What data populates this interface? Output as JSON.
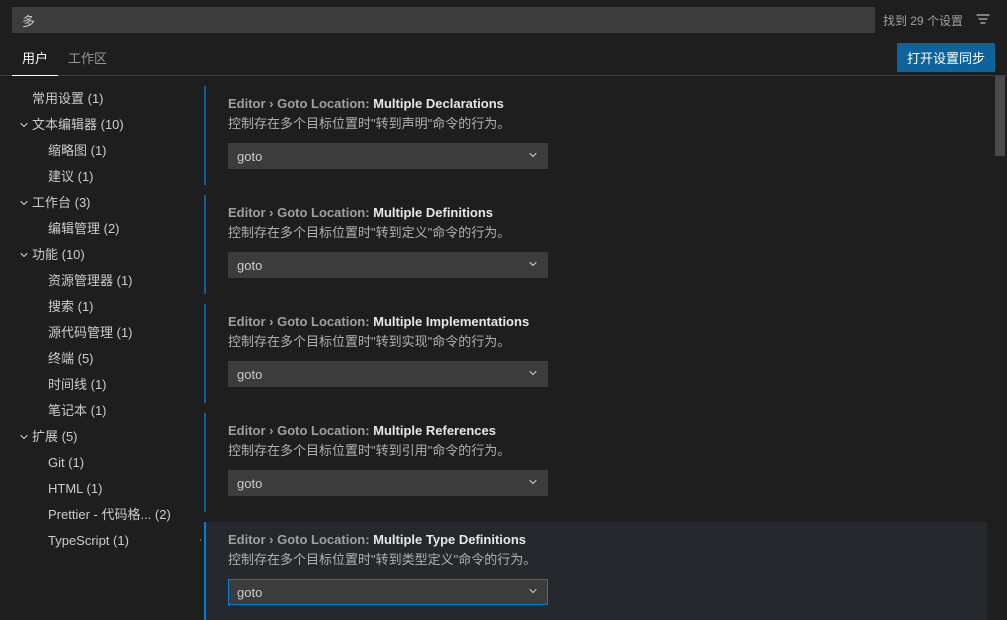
{
  "search": {
    "query": "多",
    "count": "找到 29 个设置"
  },
  "tabs": {
    "user": "用户",
    "workspace": "工作区",
    "sync": "打开设置同步"
  },
  "sidebar": [
    {
      "label": "常用设置 (1)",
      "kind": "leaf"
    },
    {
      "label": "文本编辑器 (10)",
      "kind": "expand",
      "children": [
        {
          "label": "缩略图 (1)"
        },
        {
          "label": "建议 (1)"
        }
      ]
    },
    {
      "label": "工作台 (3)",
      "kind": "expand",
      "children": [
        {
          "label": "编辑管理 (2)"
        }
      ]
    },
    {
      "label": "功能 (10)",
      "kind": "expand",
      "children": [
        {
          "label": "资源管理器 (1)"
        },
        {
          "label": "搜索 (1)"
        },
        {
          "label": "源代码管理 (1)"
        },
        {
          "label": "终端 (5)"
        },
        {
          "label": "时间线 (1)"
        },
        {
          "label": "笔记本 (1)"
        }
      ]
    },
    {
      "label": "扩展 (5)",
      "kind": "expand",
      "children": [
        {
          "label": "Git (1)"
        },
        {
          "label": "HTML (1)"
        },
        {
          "label": "Prettier - 代码格... (2)"
        },
        {
          "label": "TypeScript (1)"
        }
      ]
    }
  ],
  "settings": [
    {
      "crumb": "Editor › Goto Location: ",
      "name": "Multiple Declarations",
      "desc": "控制存在多个目标位置时\"转到声明\"命令的行为。",
      "value": "goto",
      "active": false
    },
    {
      "crumb": "Editor › Goto Location: ",
      "name": "Multiple Definitions",
      "desc": "控制存在多个目标位置时\"转到定义\"命令的行为。",
      "value": "goto",
      "active": false
    },
    {
      "crumb": "Editor › Goto Location: ",
      "name": "Multiple Implementations",
      "desc": "控制存在多个目标位置时\"转到实现\"命令的行为。",
      "value": "goto",
      "active": false
    },
    {
      "crumb": "Editor › Goto Location: ",
      "name": "Multiple References",
      "desc": "控制存在多个目标位置时\"转到引用\"命令的行为。",
      "value": "goto",
      "active": false
    },
    {
      "crumb": "Editor › Goto Location: ",
      "name": "Multiple Type Definitions",
      "desc": "控制存在多个目标位置时\"转到类型定义\"命令的行为。",
      "value": "goto",
      "active": true
    }
  ]
}
